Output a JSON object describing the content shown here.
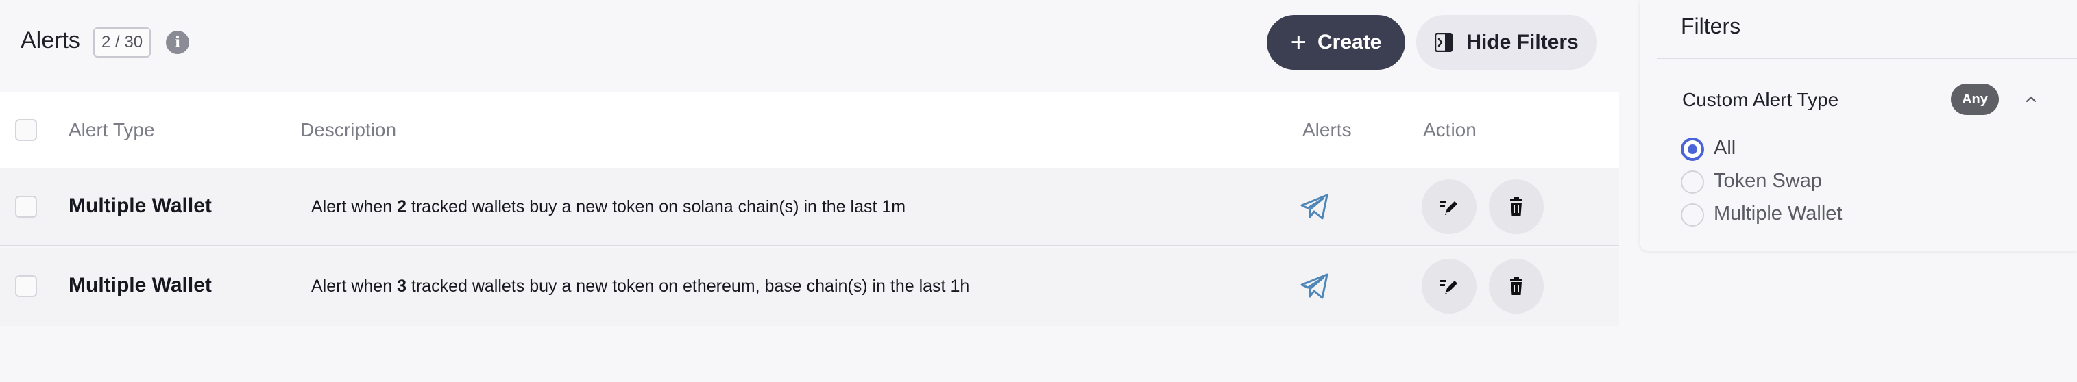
{
  "header": {
    "title": "Alerts",
    "count": "2 / 30",
    "info_icon": "i",
    "create_label": "Create",
    "hide_filters_label": "Hide Filters"
  },
  "table": {
    "columns": [
      "Alert Type",
      "Description",
      "Alerts",
      "Action"
    ],
    "rows": [
      {
        "type": "Multiple Wallet",
        "desc_pre": "Alert when ",
        "desc_num": "2",
        "desc_post": " tracked wallets buy a new token on solana chain(s) in the last 1m",
        "alert_icon": "telegram-icon",
        "actions": [
          "edit-icon",
          "trash-icon"
        ]
      },
      {
        "type": "Multiple Wallet",
        "desc_pre": "Alert when ",
        "desc_num": "3",
        "desc_post": " tracked wallets buy a new token on ethereum, base chain(s) in the last 1h",
        "alert_icon": "telegram-icon",
        "actions": [
          "edit-icon",
          "trash-icon"
        ]
      }
    ]
  },
  "filters": {
    "title": "Filters",
    "group_label": "Custom Alert Type",
    "group_badge": "Any",
    "options": [
      {
        "label": "All",
        "selected": true
      },
      {
        "label": "Token Swap",
        "selected": false
      },
      {
        "label": "Multiple Wallet",
        "selected": false
      }
    ]
  },
  "colors": {
    "primary_button": "#3c3f52",
    "radio_selected": "#4a64d8",
    "telegram_icon": "#4f87b8"
  }
}
